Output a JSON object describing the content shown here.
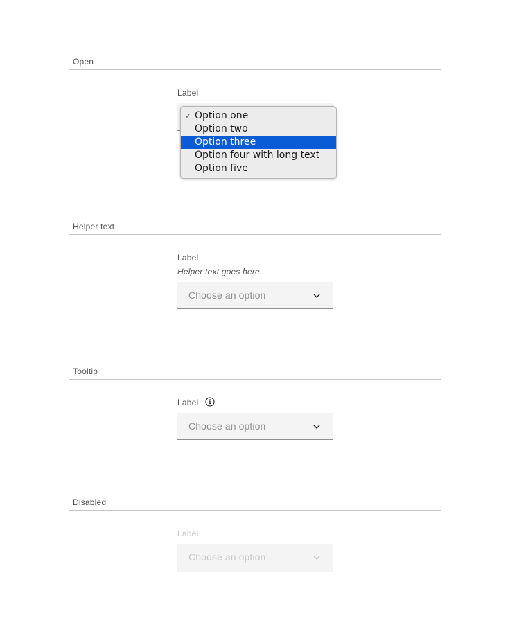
{
  "sections": {
    "open": {
      "title": "Open",
      "label": "Label",
      "options": [
        {
          "label": "Option one",
          "checked": true,
          "highlighted": false
        },
        {
          "label": "Option two",
          "checked": false,
          "highlighted": false
        },
        {
          "label": "Option three",
          "checked": false,
          "highlighted": true
        },
        {
          "label": "Option four with long text",
          "checked": false,
          "highlighted": false
        },
        {
          "label": "Option five",
          "checked": false,
          "highlighted": false
        }
      ],
      "check_glyph": "✓"
    },
    "helper": {
      "title": "Helper text",
      "label": "Label",
      "helper_text": "Helper text goes here.",
      "value": "Choose an option"
    },
    "tooltip": {
      "title": "Tooltip",
      "label": "Label",
      "value": "Choose an option",
      "icon": "info-icon"
    },
    "disabled": {
      "title": "Disabled",
      "label": "Label",
      "value": "Choose an option"
    }
  },
  "colors": {
    "field_bg": "#f4f4f4",
    "highlight": "#0a5cd6",
    "divider": "#c6c6c6",
    "placeholder": "#8d8d8d",
    "disabled_text": "#c6c6c6"
  }
}
